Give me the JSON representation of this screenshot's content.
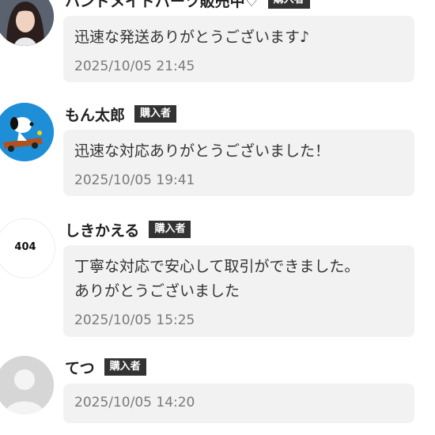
{
  "reviews": [
    {
      "name": "ハンドメイドパーツ販売中♡",
      "badge": "購入者",
      "message": "迅速な発送ありがとうございます♪",
      "time": "2025/10/05 21:45",
      "avatar": "person-photo-icon"
    },
    {
      "name": "もん太郎",
      "badge": "購入者",
      "message": "迅速な対応ありがとうございました！",
      "time": "2025/10/05 19:41",
      "avatar": "snoopy-car-icon"
    },
    {
      "name": "しきかえる",
      "badge": "購入者",
      "message": "丁寧な対応で安心して取引ができました。\nありがとうございました",
      "time": "2025/10/05 15:25",
      "avatar_text": "404",
      "avatar": "not-found-icon"
    },
    {
      "name": "てつ",
      "badge": "購入者",
      "message": "",
      "time": "2025/10/05 14:20",
      "avatar": "default-user-icon"
    }
  ],
  "colors": {
    "badge_bg": "#333333",
    "bubble_bg": "#f2f2f2",
    "timestamp": "#7a7a7a",
    "avatar_blue": "#1e8fd6"
  }
}
